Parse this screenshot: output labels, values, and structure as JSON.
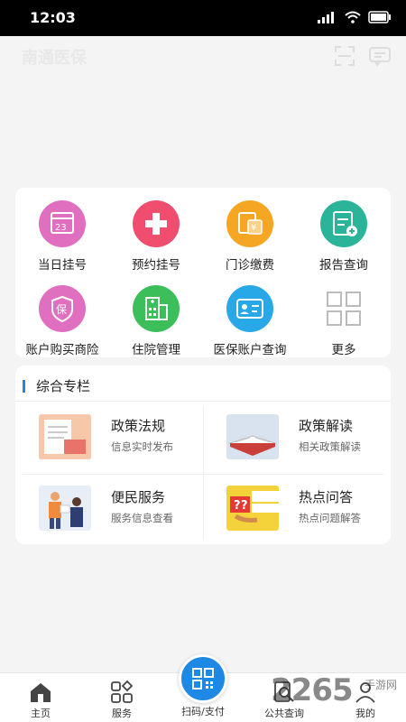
{
  "status_bar": {
    "time": "12:03"
  },
  "app_bar": {
    "title": "南通医保"
  },
  "services": [
    {
      "label": "当日挂号",
      "icon": "calendar-icon",
      "color": "#e06fc0"
    },
    {
      "label": "预约挂号",
      "icon": "hospital-cross-icon",
      "color": "#ef4e6e"
    },
    {
      "label": "门诊缴费",
      "icon": "payment-icon",
      "color": "#f5a623"
    },
    {
      "label": "报告查询",
      "icon": "report-icon",
      "color": "#2bb49a"
    },
    {
      "label": "账户购买商险",
      "icon": "insurance-icon",
      "color": "#e06fc0"
    },
    {
      "label": "住院管理",
      "icon": "hospital-building-icon",
      "color": "#3cbf5a"
    },
    {
      "label": "医保账户查询",
      "icon": "id-card-icon",
      "color": "#29a8e8"
    },
    {
      "label": "更多",
      "icon": "more-grid-icon",
      "color": "#bbbbbb"
    }
  ],
  "section": {
    "title": "综合专栏",
    "tiles": [
      {
        "title": "政策法规",
        "subtitle": "信息实时发布",
        "icon": "document-image"
      },
      {
        "title": "政策解读",
        "subtitle": "相关政策解读",
        "icon": "book-image"
      },
      {
        "title": "便民服务",
        "subtitle": "服务信息查看",
        "icon": "people-image"
      },
      {
        "title": "热点问答",
        "subtitle": "热点问题解答",
        "icon": "question-image"
      }
    ]
  },
  "tabs": [
    {
      "label": "主页",
      "icon": "home-icon"
    },
    {
      "label": "服务",
      "icon": "apps-icon"
    },
    {
      "label": "扫码/支付",
      "icon": "qr-scan-icon"
    },
    {
      "label": "公共查询",
      "icon": "search-doc-icon"
    },
    {
      "label": "我的",
      "icon": "user-icon"
    }
  ],
  "watermark": {
    "text": "2265",
    "sub": "手游网"
  },
  "colors": {
    "accent": "#1e88e5"
  }
}
